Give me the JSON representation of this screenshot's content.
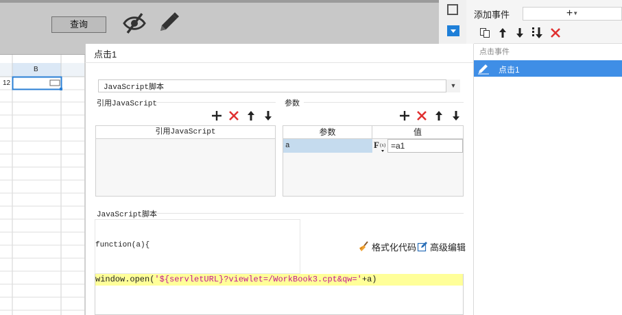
{
  "preview": {
    "query_button": "查询"
  },
  "grid": {
    "column_b": "B",
    "row_number": "12"
  },
  "right_panel": {
    "add_event_label": "添加事件",
    "add_event_button": "+",
    "list_header": "点击事件",
    "events": [
      {
        "label": "点击1",
        "selected": true
      }
    ]
  },
  "dialog": {
    "title": "点击1",
    "type_select": {
      "value": "JavaScript脚本"
    },
    "ref_js": {
      "section": "引用JavaScript",
      "column_header": "引用JavaScript"
    },
    "params": {
      "section": "参数",
      "headers": [
        "参数",
        "值"
      ],
      "rows": [
        {
          "name": "a",
          "value": "=a1"
        }
      ]
    },
    "script": {
      "section": "JavaScript脚本",
      "signature": "function(a){",
      "format_label": "格式化代码",
      "advanced_label": "高级编辑",
      "code_prefix": "window.open(",
      "code_string": "'${servletURL}?viewlet=/WorkBook3.cpt&qw='",
      "code_suffix": "+a)"
    }
  },
  "colors": {
    "accent": "#3f8ee6",
    "delete": "#e03030",
    "highlight_line": "#ffff99",
    "string_literal": "#c01890",
    "param_selected": "#c5dbee"
  },
  "icons": [
    "eye-off-icon",
    "pencil-icon",
    "square-icon",
    "dropdown-icon",
    "copy-icon",
    "arrow-up-icon",
    "arrow-down-icon",
    "move-bottom-icon",
    "delete-icon",
    "add-icon",
    "broom-icon",
    "edit-box-icon"
  ]
}
